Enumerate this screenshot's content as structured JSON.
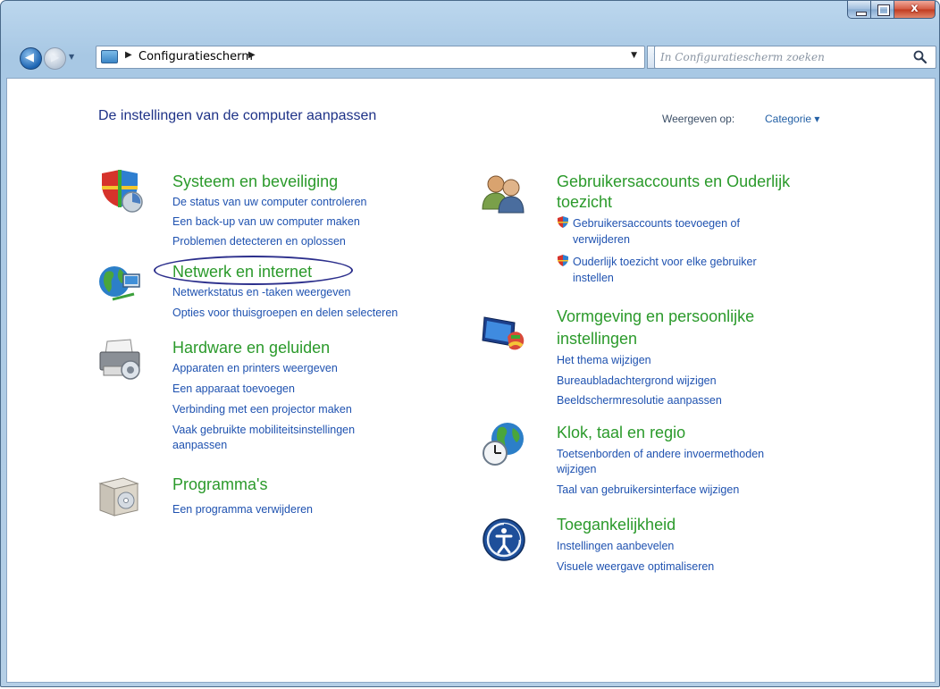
{
  "window": {
    "controls": {
      "minimize": "",
      "maximize": "",
      "close": "x"
    }
  },
  "address": {
    "path": "Configuratiescherm",
    "dropdown_icon": "chevron-down-icon",
    "refresh_icon": "refresh-icon"
  },
  "search": {
    "placeholder": "In Configuratiescherm zoeken"
  },
  "header": {
    "title": "De instellingen van de computer aanpassen",
    "view_label": "Weergeven op:",
    "view_value": "Categorie ▾"
  },
  "categories": {
    "system": {
      "title": "Systeem en beveiliging",
      "links": [
        "De status van uw computer controleren",
        "Een back-up van uw computer maken",
        "Problemen detecteren en oplossen"
      ]
    },
    "network": {
      "title": "Netwerk en internet",
      "links": [
        "Netwerkstatus en -taken weergeven",
        "Opties voor thuisgroepen en delen selecteren"
      ]
    },
    "hardware": {
      "title": "Hardware en geluiden",
      "links": [
        "Apparaten en printers weergeven",
        "Een apparaat toevoegen",
        "Verbinding met een projector maken",
        "Vaak gebruikte mobiliteitsinstellingen",
        "aanpassen"
      ]
    },
    "programs": {
      "title": "Programma's",
      "links": [
        "Een programma verwijderen"
      ]
    },
    "users": {
      "title_line1": "Gebruikersaccounts en Ouderlijk",
      "title_line2": "toezicht",
      "links": [
        "Gebruikersaccounts toevoegen of",
        "verwijderen",
        "Ouderlijk toezicht voor elke gebruiker",
        "instellen"
      ]
    },
    "appearance": {
      "title_line1": "Vormgeving en persoonlijke",
      "title_line2": "instellingen",
      "links": [
        "Het thema wijzigen",
        "Bureaubladachtergrond wijzigen",
        "Beeldschermresolutie aanpassen"
      ]
    },
    "clock": {
      "title": "Klok, taal en regio",
      "links": [
        "Toetsenborden of andere invoermethoden",
        "wijzigen",
        "Taal van gebruikersinterface wijzigen"
      ]
    },
    "access": {
      "title": "Toegankelijkheid",
      "links": [
        "Instellingen aanbevelen",
        "Visuele weergave optimaliseren"
      ]
    }
  }
}
